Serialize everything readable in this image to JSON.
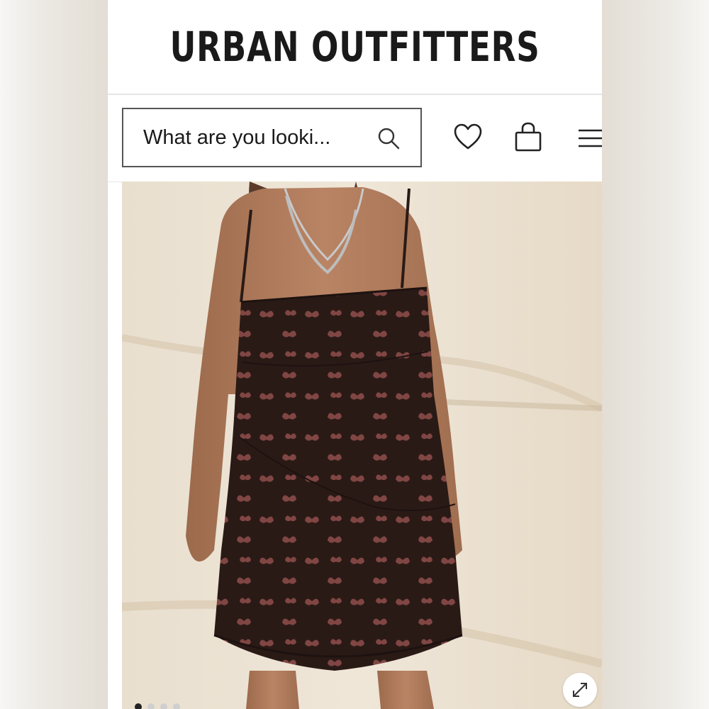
{
  "header": {
    "brand": "URBAN OUTFITTERS"
  },
  "search": {
    "placeholder": "What are you looki..."
  },
  "icons": {
    "search": "search-icon",
    "wishlist": "heart-icon",
    "bag": "shopping-bag-icon",
    "menu": "hamburger-menu-icon",
    "expand": "expand-icon"
  },
  "product": {
    "image": "photo of model wearing black mini slip dress with pink butterfly print",
    "carousel_slide_count": 4,
    "carousel_active_index": 0
  },
  "colors": {
    "brand_text": "#1a1a1a",
    "dress": "#2a1a16",
    "butterfly_print": "#8a4a48",
    "backdrop": "#e7dccb"
  }
}
